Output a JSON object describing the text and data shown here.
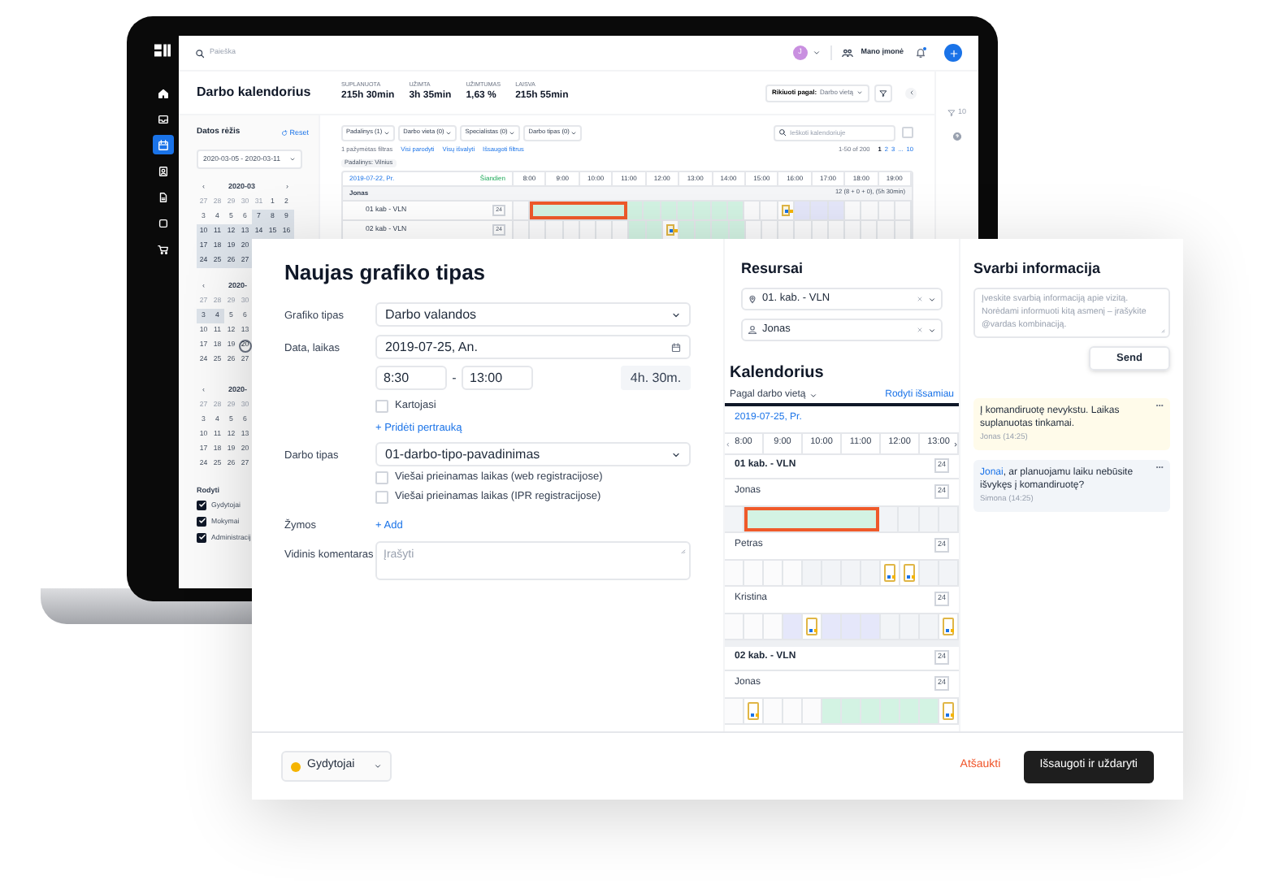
{
  "sidebar": {
    "items": [
      {
        "kind": "home",
        "selected": false
      },
      {
        "kind": "inbox",
        "selected": false
      },
      {
        "kind": "calendar",
        "selected": true
      },
      {
        "kind": "contact",
        "selected": false
      },
      {
        "kind": "file",
        "selected": false
      },
      {
        "kind": "square",
        "selected": false
      },
      {
        "kind": "cart",
        "selected": false
      }
    ]
  },
  "topbar": {
    "search_placeholder": "Paieška",
    "avatar": "J",
    "company": "Mano įmonė"
  },
  "header": {
    "title": "Darbo kalendorius",
    "stats": [
      {
        "label": "SUPLANUOTA",
        "value": "215h 30min"
      },
      {
        "label": "UŽIMTA",
        "value": "3h 35min"
      },
      {
        "label": "UŽIMTUMAS",
        "value": "1,63 %"
      },
      {
        "label": "LAISVA",
        "value": "215h 55min"
      }
    ],
    "sort": {
      "label": "Rikiuoti pagal:",
      "value": "Darbo vietą"
    }
  },
  "right_rail": {
    "filter_count": "10"
  },
  "date_panel": {
    "title": "Datos rėžis",
    "reset": "Reset",
    "range": "2020-03-05 - 2020-03-11",
    "calendars": [
      {
        "month": "2020-03",
        "prev": "‹",
        "next": "›",
        "weeks": [
          [
            {
              "text": "27",
              "kind": "other"
            },
            {
              "text": "28",
              "kind": "other"
            },
            {
              "text": "29",
              "kind": "other"
            },
            {
              "text": "30",
              "kind": "other"
            },
            {
              "text": "31",
              "kind": "other"
            },
            {
              "text": "1",
              "kind": "day"
            },
            {
              "text": "2",
              "kind": "day"
            }
          ],
          [
            {
              "text": "3",
              "kind": "day"
            },
            {
              "text": "4",
              "kind": "day"
            },
            {
              "text": "5",
              "kind": "day"
            },
            {
              "text": "6",
              "kind": "day"
            },
            {
              "text": "7",
              "kind": "range"
            },
            {
              "text": "8",
              "kind": "range"
            },
            {
              "text": "9",
              "kind": "range"
            }
          ],
          [
            {
              "text": "10",
              "kind": "range"
            },
            {
              "text": "11",
              "kind": "range"
            },
            {
              "text": "12",
              "kind": "range"
            },
            {
              "text": "13",
              "kind": "range"
            },
            {
              "text": "14",
              "kind": "range"
            },
            {
              "text": "15",
              "kind": "range"
            },
            {
              "text": "16",
              "kind": "range"
            }
          ],
          [
            {
              "text": "17",
              "kind": "range"
            },
            {
              "text": "18",
              "kind": "range"
            },
            {
              "text": "19",
              "kind": "range"
            },
            {
              "text": "20",
              "kind": "range"
            }
          ],
          [
            {
              "text": "24",
              "kind": "range"
            },
            {
              "text": "25",
              "kind": "range"
            },
            {
              "text": "26",
              "kind": "range"
            },
            {
              "text": "27",
              "kind": "range"
            }
          ]
        ]
      },
      {
        "month": "2020-",
        "prev": "‹",
        "weeks": [
          [
            {
              "text": "27",
              "kind": "other"
            },
            {
              "text": "28",
              "kind": "other"
            },
            {
              "text": "29",
              "kind": "other"
            },
            {
              "text": "30",
              "kind": "other"
            }
          ],
          [
            {
              "text": "3",
              "kind": "range"
            },
            {
              "text": "4",
              "kind": "range"
            },
            {
              "text": "5",
              "kind": "day"
            },
            {
              "text": "6",
              "kind": "day"
            }
          ],
          [
            {
              "text": "10",
              "kind": "day"
            },
            {
              "text": "11",
              "kind": "day"
            },
            {
              "text": "12",
              "kind": "day"
            },
            {
              "text": "13",
              "kind": "day"
            }
          ],
          [
            {
              "text": "17",
              "kind": "day"
            },
            {
              "text": "18",
              "kind": "day"
            },
            {
              "text": "19",
              "kind": "day"
            },
            {
              "text": "20",
              "kind": "today"
            }
          ],
          [
            {
              "text": "24",
              "kind": "day"
            },
            {
              "text": "25",
              "kind": "day"
            },
            {
              "text": "26",
              "kind": "day"
            },
            {
              "text": "27",
              "kind": "day"
            }
          ]
        ]
      },
      {
        "month": "2020-",
        "prev": "‹",
        "weeks": [
          [
            {
              "text": "27",
              "kind": "other"
            },
            {
              "text": "28",
              "kind": "other"
            },
            {
              "text": "29",
              "kind": "other"
            },
            {
              "text": "30",
              "kind": "other"
            }
          ],
          [
            {
              "text": "3",
              "kind": "day"
            },
            {
              "text": "4",
              "kind": "day"
            },
            {
              "text": "5",
              "kind": "day"
            },
            {
              "text": "6",
              "kind": "day"
            }
          ],
          [
            {
              "text": "10",
              "kind": "day"
            },
            {
              "text": "11",
              "kind": "day"
            },
            {
              "text": "12",
              "kind": "day"
            },
            {
              "text": "13",
              "kind": "day"
            }
          ],
          [
            {
              "text": "17",
              "kind": "day"
            },
            {
              "text": "18",
              "kind": "day"
            },
            {
              "text": "19",
              "kind": "day"
            },
            {
              "text": "20",
              "kind": "day"
            }
          ],
          [
            {
              "text": "24",
              "kind": "day"
            },
            {
              "text": "25",
              "kind": "day"
            },
            {
              "text": "26",
              "kind": "day"
            },
            {
              "text": "27",
              "kind": "day"
            }
          ]
        ]
      }
    ],
    "show": {
      "title": "Rodyti",
      "options": [
        {
          "label": "Gydytojai",
          "checked": true
        },
        {
          "label": "Mokymai",
          "checked": true
        },
        {
          "label": "Administracij",
          "checked": true
        }
      ]
    }
  },
  "filters": {
    "dropdowns": [
      "Padalinys (1)",
      "Darbo vieta (0)",
      "Specialistas (0)",
      "Darbo tipas (0)"
    ],
    "search_placeholder": "Ieškoti kalendoriuje",
    "checkbox": {
      "checked": false
    },
    "summary": "1 pažymėtas filtras",
    "links": [
      "Visi parodyti",
      "Visų išvalyti",
      "Išsaugoti filtrus"
    ],
    "tags": [
      "Padalinys: Vilnius"
    ],
    "pagination": {
      "range": "1-50 of 200",
      "pages": [
        {
          "label": "1",
          "selected": true
        },
        {
          "label": "2",
          "selected": false
        },
        {
          "label": "3",
          "selected": false
        },
        {
          "label": "...",
          "selected": false
        },
        {
          "label": "10",
          "selected": false
        }
      ]
    }
  },
  "schedule": {
    "date": "2019-07-22, Pr.",
    "today": "Šiandien",
    "hours": [
      "8:00",
      "9:00",
      "10:00",
      "11:00",
      "12:00",
      "13:00",
      "14:00",
      "15:00",
      "16:00",
      "17:00",
      "18:00",
      "19:00"
    ],
    "groups": [
      {
        "name": "Jonas",
        "summary": "12 (8 + 0 + 0), (5h 30min)",
        "rows": [
          {
            "name": "01 kab - VLN",
            "badge": "24",
            "cells": [
              {
                "kind": "free"
              },
              {
                "kind": "selected"
              },
              {
                "kind": "selected"
              },
              {
                "kind": "selected"
              },
              {
                "kind": "selected"
              },
              {
                "kind": "selected"
              },
              {
                "kind": "selected"
              },
              {
                "kind": "booked"
              },
              {
                "kind": "booked"
              },
              {
                "kind": "booked"
              },
              {
                "kind": "booked"
              },
              {
                "kind": "booked"
              },
              {
                "kind": "booked"
              },
              {
                "kind": "booked"
              },
              {
                "kind": "free"
              },
              {
                "kind": "free"
              },
              {
                "kind": "event"
              },
              {
                "kind": "unavailable"
              },
              {
                "kind": "unavailable"
              },
              {
                "kind": "unavailable"
              },
              {
                "kind": "free"
              },
              {
                "kind": "free"
              },
              {
                "kind": "free"
              },
              {
                "kind": "free"
              }
            ]
          },
          {
            "name": "02 kab - VLN",
            "badge": "24",
            "cells": [
              {
                "kind": "free"
              },
              {
                "kind": "free"
              },
              {
                "kind": "free"
              },
              {
                "kind": "free"
              },
              {
                "kind": "free"
              },
              {
                "kind": "free"
              },
              {
                "kind": "free"
              },
              {
                "kind": "booked"
              },
              {
                "kind": "booked"
              },
              {
                "kind": "event"
              },
              {
                "kind": "booked"
              },
              {
                "kind": "booked"
              },
              {
                "kind": "booked"
              },
              {
                "kind": "booked"
              },
              {
                "kind": "free"
              },
              {
                "kind": "free"
              },
              {
                "kind": "free"
              },
              {
                "kind": "free"
              },
              {
                "kind": "free"
              },
              {
                "kind": "free"
              },
              {
                "kind": "free"
              },
              {
                "kind": "free"
              },
              {
                "kind": "free"
              },
              {
                "kind": "free"
              }
            ]
          }
        ]
      }
    ]
  },
  "dialog": {
    "title": "Naujas grafiko tipas",
    "form": {
      "schedule_type": {
        "label": "Grafiko tipas",
        "value": "Darbo valandos"
      },
      "date": {
        "label": "Data, laikas",
        "value": "2019-07-25, An."
      },
      "start": "8:30",
      "separator": "-",
      "end": "13:00",
      "duration": "4h. 30m.",
      "repeat": {
        "label": "Kartojasi",
        "checked": false
      },
      "add_break": "+ Pridėti pertrauką",
      "work_type": {
        "label": "Darbo tipas",
        "value": "01-darbo-tipo-pavadinimas"
      },
      "visibility": [
        {
          "label": "Viešai prieinamas laikas (web registracijose)",
          "checked": false
        },
        {
          "label": "Viešai prieinamas laikas (IPR registracijose)",
          "checked": false
        }
      ],
      "tags": {
        "label": "Žymos",
        "add": "+ Add"
      },
      "comment": {
        "label": "Vidinis komentaras",
        "placeholder": "Įrašyti"
      }
    },
    "resources": {
      "title": "Resursai",
      "fields": [
        {
          "kind": "place",
          "value": "01. kab. - VLN"
        },
        {
          "kind": "person",
          "value": "Jonas"
        }
      ]
    },
    "calendar": {
      "title": "Kalendorius",
      "view": "Pagal darbo vietą",
      "details": "Rodyti išsamiau",
      "date": "2019-07-25, Pr.",
      "prev": "‹",
      "next": "›",
      "hours": [
        "8:00",
        "9:00",
        "10:00",
        "11:00",
        "12:00",
        "13:00"
      ],
      "groups": [
        {
          "name": "01 kab. - VLN",
          "badge": "24",
          "people": [
            {
              "name": "Jonas",
              "badge": "24",
              "cells": [
                {
                  "kind": "off"
                },
                {
                  "kind": "selected"
                },
                {
                  "kind": "selected"
                },
                {
                  "kind": "selected"
                },
                {
                  "kind": "selected"
                },
                {
                  "kind": "selected"
                },
                {
                  "kind": "selected"
                },
                {
                  "kind": "selected"
                },
                {
                  "kind": "off"
                },
                {
                  "kind": "off"
                },
                {
                  "kind": "off"
                },
                {
                  "kind": "off"
                }
              ]
            },
            {
              "name": "Petras",
              "badge": "24",
              "cells": [
                {
                  "kind": "free"
                },
                {
                  "kind": "free"
                },
                {
                  "kind": "free"
                },
                {
                  "kind": "free"
                },
                {
                  "kind": "off"
                },
                {
                  "kind": "off"
                },
                {
                  "kind": "off"
                },
                {
                  "kind": "off"
                },
                {
                  "kind": "event"
                },
                {
                  "kind": "event"
                },
                {
                  "kind": "off"
                },
                {
                  "kind": "off"
                }
              ]
            },
            {
              "name": "Kristina",
              "badge": "24",
              "cells": [
                {
                  "kind": "free"
                },
                {
                  "kind": "free"
                },
                {
                  "kind": "free"
                },
                {
                  "kind": "unavailable"
                },
                {
                  "kind": "event"
                },
                {
                  "kind": "unavailable"
                },
                {
                  "kind": "unavailable"
                },
                {
                  "kind": "unavailable"
                },
                {
                  "kind": "off"
                },
                {
                  "kind": "off"
                },
                {
                  "kind": "off"
                },
                {
                  "kind": "event"
                }
              ]
            }
          ]
        },
        {
          "name": "02 kab. - VLN",
          "badge": "24",
          "people": [
            {
              "name": "Jonas",
              "badge": "24",
              "cells": [
                {
                  "kind": "free"
                },
                {
                  "kind": "event"
                },
                {
                  "kind": "free"
                },
                {
                  "kind": "free"
                },
                {
                  "kind": "free"
                },
                {
                  "kind": "booked"
                },
                {
                  "kind": "booked"
                },
                {
                  "kind": "booked"
                },
                {
                  "kind": "booked"
                },
                {
                  "kind": "booked"
                },
                {
                  "kind": "booked"
                },
                {
                  "kind": "event"
                }
              ]
            }
          ]
        }
      ]
    },
    "info": {
      "title": "Svarbi informacija",
      "placeholder": "Įveskite svarbią informaciją apie vizitą. Norėdami informuoti kitą asmenį – įrašykite @vardas kombinaciją.",
      "send": "Send",
      "messages": [
        {
          "kind": "own",
          "text": "Į komandiruotę nevykstu. Laikas suplanuotas tinkamai.",
          "author": "Jonas (14:25)"
        },
        {
          "kind": "other",
          "mention": "Jonai",
          "text": ", ar planuojamu laiku nebūsite išvykęs į komandiruotę?",
          "author": "Simona (14:25)"
        }
      ]
    },
    "footer": {
      "category": {
        "label": "Gydytojai",
        "color": "#f5b400"
      },
      "cancel": "Atšaukti",
      "save": "Išsaugoti ir uždaryti"
    }
  }
}
